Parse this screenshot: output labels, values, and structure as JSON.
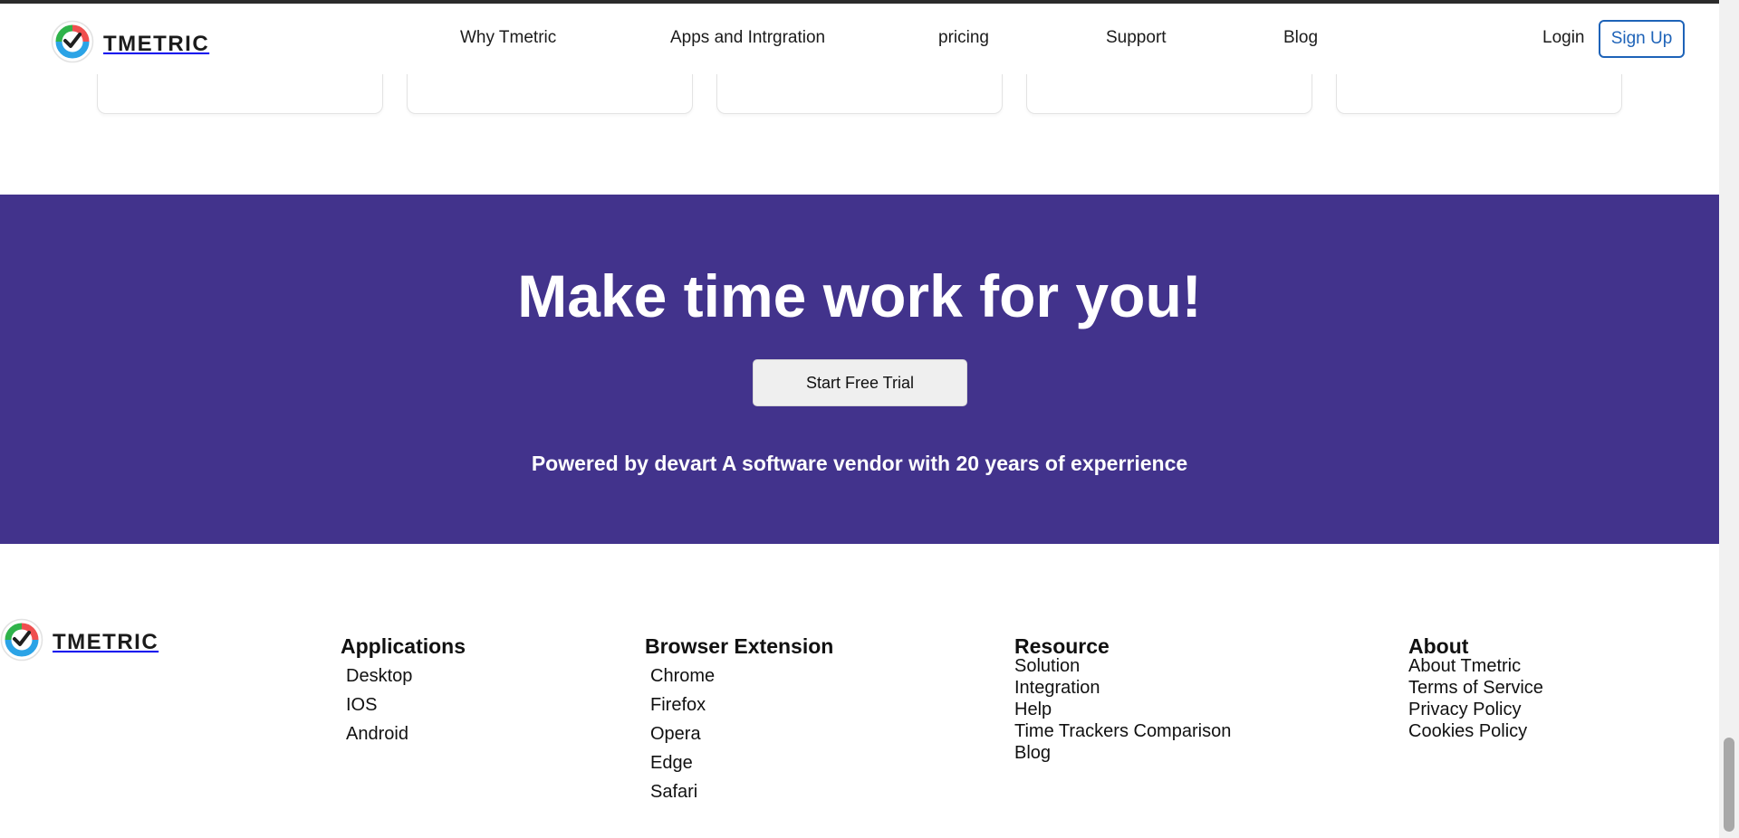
{
  "brand": {
    "name": "TMETRIC"
  },
  "nav": {
    "items": [
      "Why Tmetric",
      "Apps and Intrgration",
      "pricing",
      "Support",
      "Blog"
    ],
    "login": "Login",
    "signup": "Sign Up"
  },
  "cta": {
    "title": "Make time work for you!",
    "button": "Start Free Trial",
    "tagline": "Powered by devart A software vendor with 20 years of experrience"
  },
  "footer": {
    "brand": "TMETRIC",
    "columns": [
      {
        "heading": "Applications",
        "links": [
          "Desktop",
          "IOS",
          "Android"
        ]
      },
      {
        "heading": "Browser Extension",
        "links": [
          "Chrome",
          "Firefox",
          "Opera",
          "Edge",
          "Safari"
        ]
      },
      {
        "heading": "Resource",
        "links": [
          "Solution",
          "Integration",
          "Help",
          "Time Trackers Comparison",
          "Blog"
        ]
      },
      {
        "heading": "About",
        "links": [
          "About Tmetric",
          "Terms of Service",
          "Privacy Policy",
          "Cookies Policy"
        ]
      }
    ]
  },
  "colors": {
    "cta_background": "#42338c",
    "signup_accent": "#1e63b8",
    "logo_green": "#2fb34a",
    "logo_red": "#ef4f4f",
    "logo_blue": "#2ba3e6"
  },
  "icons": {
    "logo": "tmetric-logo-icon"
  }
}
